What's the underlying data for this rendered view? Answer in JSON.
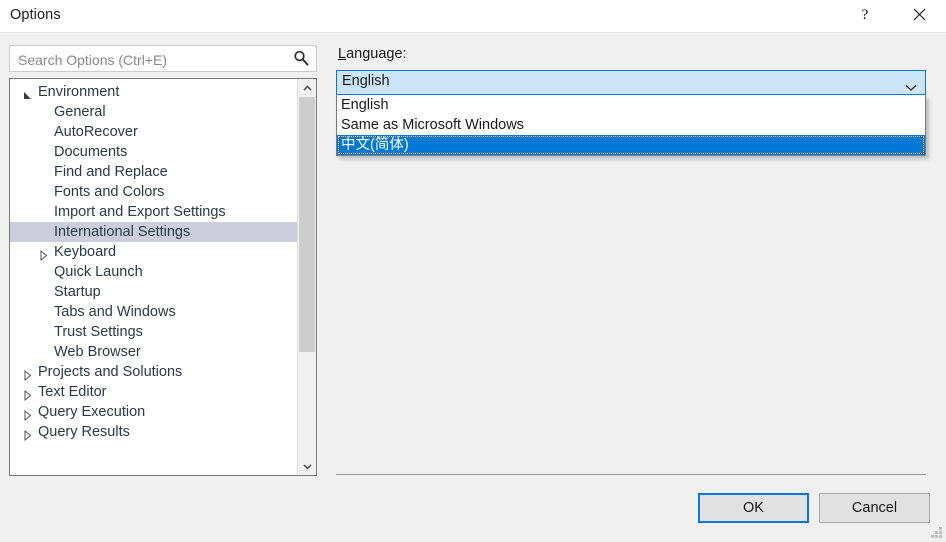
{
  "window": {
    "title": "Options",
    "help_label": "?",
    "close_label": "✕",
    "help_icon": "question-mark-icon",
    "close_icon": "close-icon"
  },
  "search": {
    "placeholder": "Search Options (Ctrl+E)",
    "value": "",
    "icon": "search-icon"
  },
  "tree": {
    "items": [
      {
        "label": "Environment",
        "depth": 0,
        "state": "expanded",
        "selected": false
      },
      {
        "label": "General",
        "depth": 1,
        "state": "leaf",
        "selected": false
      },
      {
        "label": "AutoRecover",
        "depth": 1,
        "state": "leaf",
        "selected": false
      },
      {
        "label": "Documents",
        "depth": 1,
        "state": "leaf",
        "selected": false
      },
      {
        "label": "Find and Replace",
        "depth": 1,
        "state": "leaf",
        "selected": false
      },
      {
        "label": "Fonts and Colors",
        "depth": 1,
        "state": "leaf",
        "selected": false
      },
      {
        "label": "Import and Export Settings",
        "depth": 1,
        "state": "leaf",
        "selected": false
      },
      {
        "label": "International Settings",
        "depth": 1,
        "state": "leaf",
        "selected": true
      },
      {
        "label": "Keyboard",
        "depth": 1,
        "state": "collapsed",
        "selected": false
      },
      {
        "label": "Quick Launch",
        "depth": 1,
        "state": "leaf",
        "selected": false
      },
      {
        "label": "Startup",
        "depth": 1,
        "state": "leaf",
        "selected": false
      },
      {
        "label": "Tabs and Windows",
        "depth": 1,
        "state": "leaf",
        "selected": false
      },
      {
        "label": "Trust Settings",
        "depth": 1,
        "state": "leaf",
        "selected": false
      },
      {
        "label": "Web Browser",
        "depth": 1,
        "state": "leaf",
        "selected": false
      },
      {
        "label": "Projects and Solutions",
        "depth": 0,
        "state": "collapsed",
        "selected": false
      },
      {
        "label": "Text Editor",
        "depth": 0,
        "state": "collapsed",
        "selected": false
      },
      {
        "label": "Query Execution",
        "depth": 0,
        "state": "collapsed",
        "selected": false
      },
      {
        "label": "Query Results",
        "depth": 0,
        "state": "collapsed",
        "selected": false
      }
    ],
    "scrollbar": {
      "up_arrow_icon": "chevron-up-icon",
      "down_arrow_icon": "chevron-down-icon"
    }
  },
  "panel": {
    "language_label": "Language:",
    "language_accel": "L",
    "language_label_rest": "anguage:",
    "combo": {
      "value": "English",
      "arrow_icon": "chevron-down-icon",
      "expanded": true,
      "options": [
        {
          "label": "English",
          "highlighted": false
        },
        {
          "label": "Same as Microsoft Windows",
          "highlighted": false
        },
        {
          "label": "中文(简体)",
          "highlighted": true
        }
      ]
    }
  },
  "footer": {
    "ok_label": "OK",
    "cancel_label": "Cancel"
  },
  "colors": {
    "accent": "#0078D7",
    "combo_open_bg": "#CCE4F7",
    "tree_selection": "#CDCEDB",
    "dialog_bg": "#F0F0F0",
    "titlebar_bg": "#FFFFFF",
    "focus_dotted": "#F5C26B"
  }
}
